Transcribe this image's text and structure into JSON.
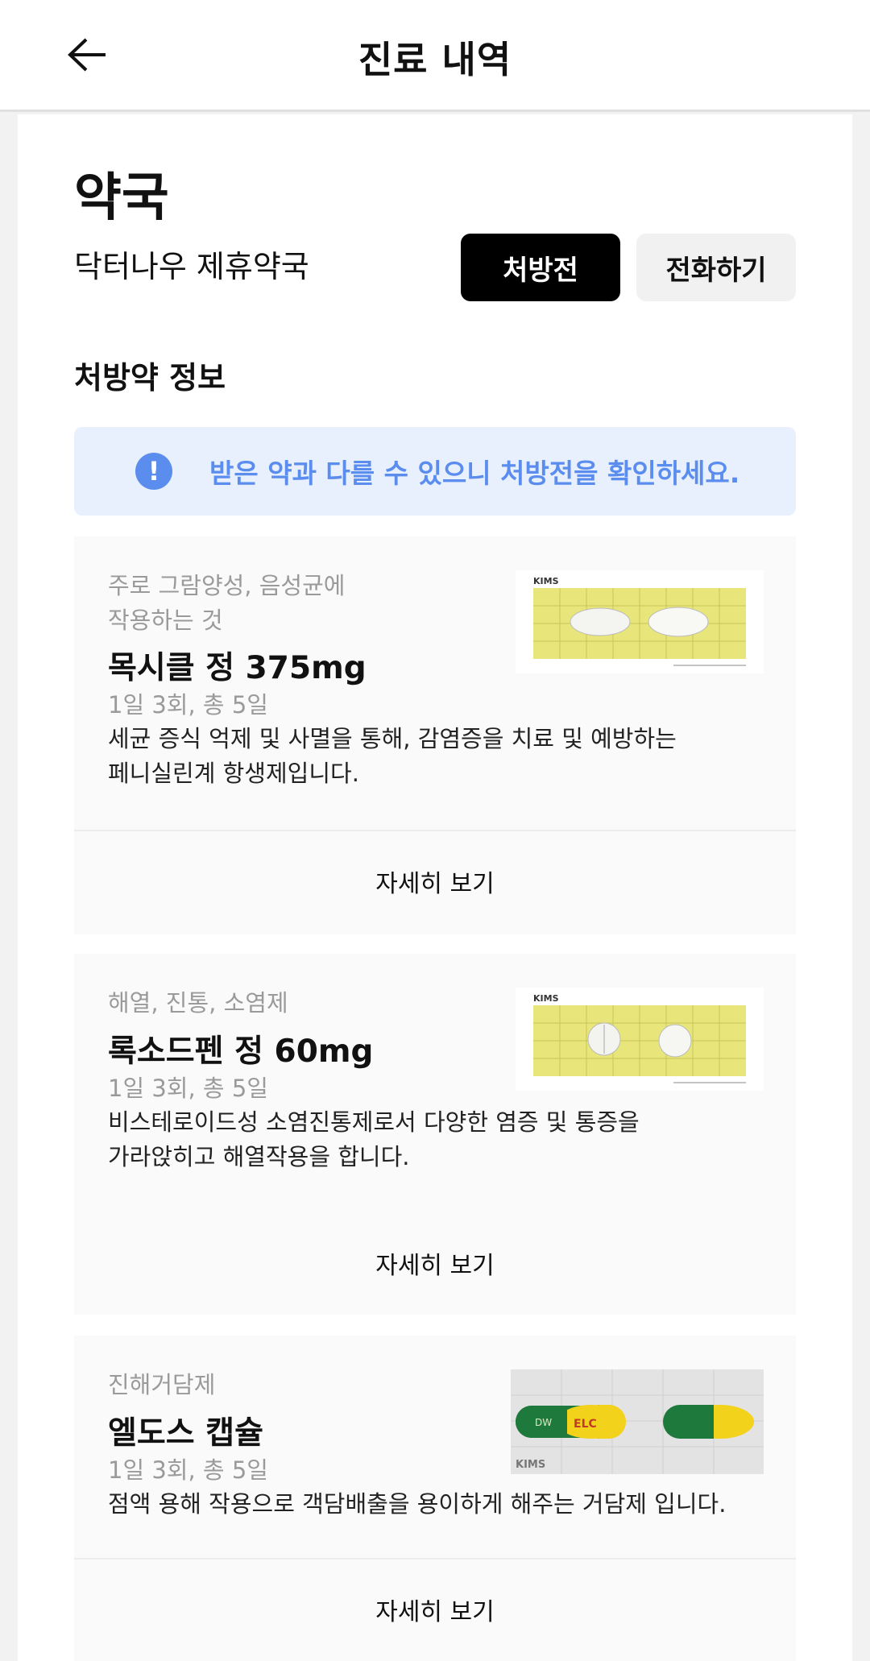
{
  "header": {
    "title": "진료 내역",
    "back_icon": "arrow-left-icon"
  },
  "pharmacy": {
    "section_title": "약국",
    "name": "닥터나우 제휴약국",
    "prescription_button": "처방전",
    "call_button": "전화하기"
  },
  "medicine_info": {
    "title": "처방약 정보",
    "notice_icon": "exclamation-circle-icon",
    "notice_text": "받은 약과 다를 수 있으니 처방전을 확인하세요."
  },
  "drugs": [
    {
      "category_line1": "주로 그람양성, 음성균에",
      "category_line2": "작용하는 것",
      "name": "목시클 정 375mg",
      "dose": "1일 3회, 총 5일",
      "desc_line1": "세균 증식 억제 및 사멸을 통해, 감염증을 치료 및 예방하는",
      "desc_line2": "페니실린계 항생제입니다.",
      "detail_label": "자세히 보기",
      "image_brand": "KIMS"
    },
    {
      "category_line1": "해열, 진통, 소염제",
      "name": "록소드펜 정 60mg",
      "dose": "1일 3회, 총 5일",
      "desc_line1": "비스테로이드성 소염진통제로서 다양한 염증 및 통증을",
      "desc_line2": "가라앉히고 해열작용을 합니다.",
      "detail_label": "자세히 보기",
      "image_brand": "KIMS"
    },
    {
      "category_line1": "진해거담제",
      "name": "엘도스 캡슐",
      "dose": "1일 3회, 총 5일",
      "desc_line1": "점액 용해 작용으로 객담배출을 용이하게 해주는 거담제 입니다.",
      "detail_label": "자세히 보기",
      "image_brand": "KIMS",
      "capsule_print_left": "DW",
      "capsule_print_right": "ELC"
    }
  ],
  "colors": {
    "accent_blue": "#5b8def",
    "notice_bg": "#e8f0fd",
    "pill_board": "#e8e57a",
    "capsule_green": "#1e7a3c",
    "capsule_yellow": "#f2d21b"
  }
}
